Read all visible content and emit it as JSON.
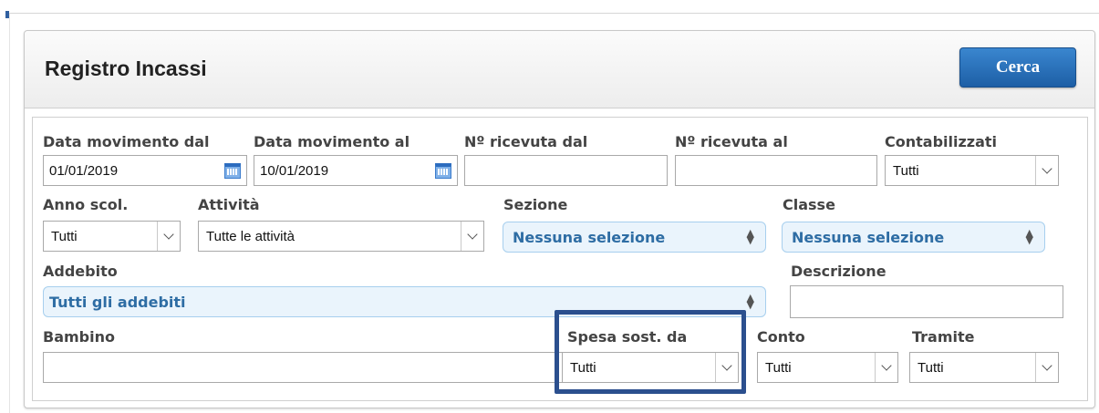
{
  "panel": {
    "title": "Registro Incassi",
    "search_button": "Cerca"
  },
  "filters": {
    "data_dal": {
      "label": "Data movimento dal",
      "value": "01/01/2019",
      "icon": "calendar-icon"
    },
    "data_al": {
      "label": "Data movimento al",
      "value": "10/01/2019",
      "icon": "calendar-icon"
    },
    "ricevuta_dal": {
      "label": "Nº ricevuta dal",
      "value": ""
    },
    "ricevuta_al": {
      "label": "Nº ricevuta al",
      "value": ""
    },
    "contabilizzati": {
      "label": "Contabilizzati",
      "value": "Tutti"
    },
    "anno_scol": {
      "label": "Anno scol.",
      "value": "Tutti"
    },
    "attivita": {
      "label": "Attività",
      "value": "Tutte le attività"
    },
    "sezione": {
      "label": "Sezione",
      "value": "Nessuna selezione"
    },
    "classe": {
      "label": "Classe",
      "value": "Nessuna selezione"
    },
    "addebito": {
      "label": "Addebito",
      "value": "Tutti gli addebiti"
    },
    "descrizione": {
      "label": "Descrizione",
      "value": ""
    },
    "bambino": {
      "label": "Bambino",
      "value": ""
    },
    "spesa_sost_da": {
      "label": "Spesa sost. da",
      "value": "Tutti"
    },
    "conto": {
      "label": "Conto",
      "value": "Tutti"
    },
    "tramite": {
      "label": "Tramite",
      "value": "Tutti"
    }
  },
  "colors": {
    "accent": "#2b6cb4",
    "highlight_border": "#2b4f8e",
    "multiselect_bg": "#eaf4fc",
    "multiselect_text": "#2e6da4"
  }
}
